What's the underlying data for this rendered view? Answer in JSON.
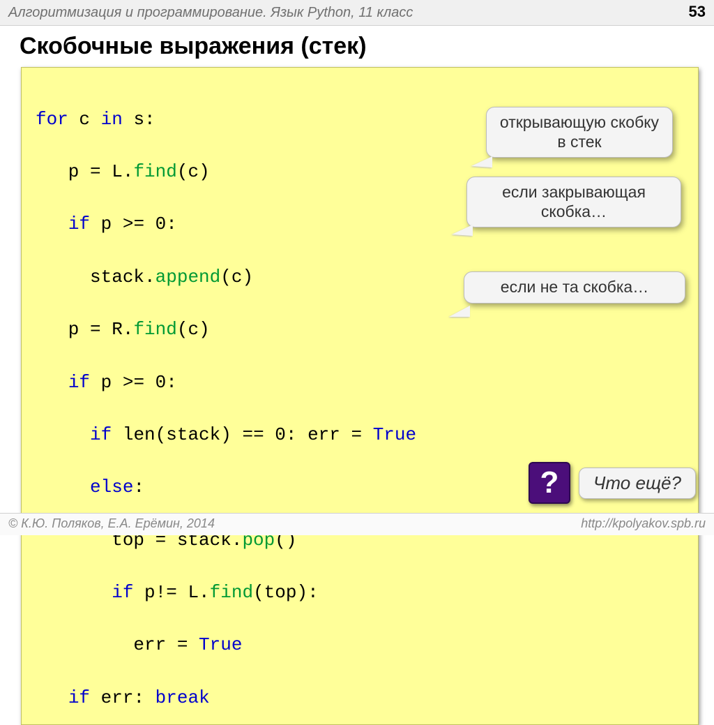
{
  "header": {
    "left": "Алгоритмизация и программирование. Язык Python, 11 класс",
    "page": "53"
  },
  "title": "Скобочные выражения (стек)",
  "code": {
    "l1a": "for",
    "l1b": " c ",
    "l1c": "in",
    "l1d": " s:",
    "l2a": "   p = L.",
    "l2b": "find",
    "l2c": "(c)",
    "l3a": "   ",
    "l3b": "if",
    "l3c": " p >= 0:",
    "l4a": "     stack.",
    "l4b": "append",
    "l4c": "(c)",
    "l5a": "   p = R.",
    "l5b": "find",
    "l5c": "(c)",
    "l6a": "   ",
    "l6b": "if",
    "l6c": " p >= 0:",
    "l7a": "     ",
    "l7b": "if",
    "l7c": " len(stack) == 0: err = ",
    "l7d": "True",
    "l8a": "     ",
    "l8b": "else",
    "l8c": ":",
    "l9a": "       top = stack.",
    "l9b": "pop",
    "l9c": "()",
    "l10a": "       ",
    "l10b": "if",
    "l10c": " p!= L.",
    "l10d": "find",
    "l10e": "(top):",
    "l11a": "         err = ",
    "l11b": "True",
    "l12a": "   ",
    "l12b": "if",
    "l12c": " err: ",
    "l12d": "break"
  },
  "callouts": {
    "c1": "открывающую скобку в стек",
    "c2": "если закрывающая скобка…",
    "c3": "если не та скобка…"
  },
  "question": {
    "mark": "?",
    "text": "Что ещё?"
  },
  "footer": {
    "left": "© К.Ю. Поляков, Е.А. Ерёмин, 2014",
    "right": "http://kpolyakov.spb.ru"
  }
}
